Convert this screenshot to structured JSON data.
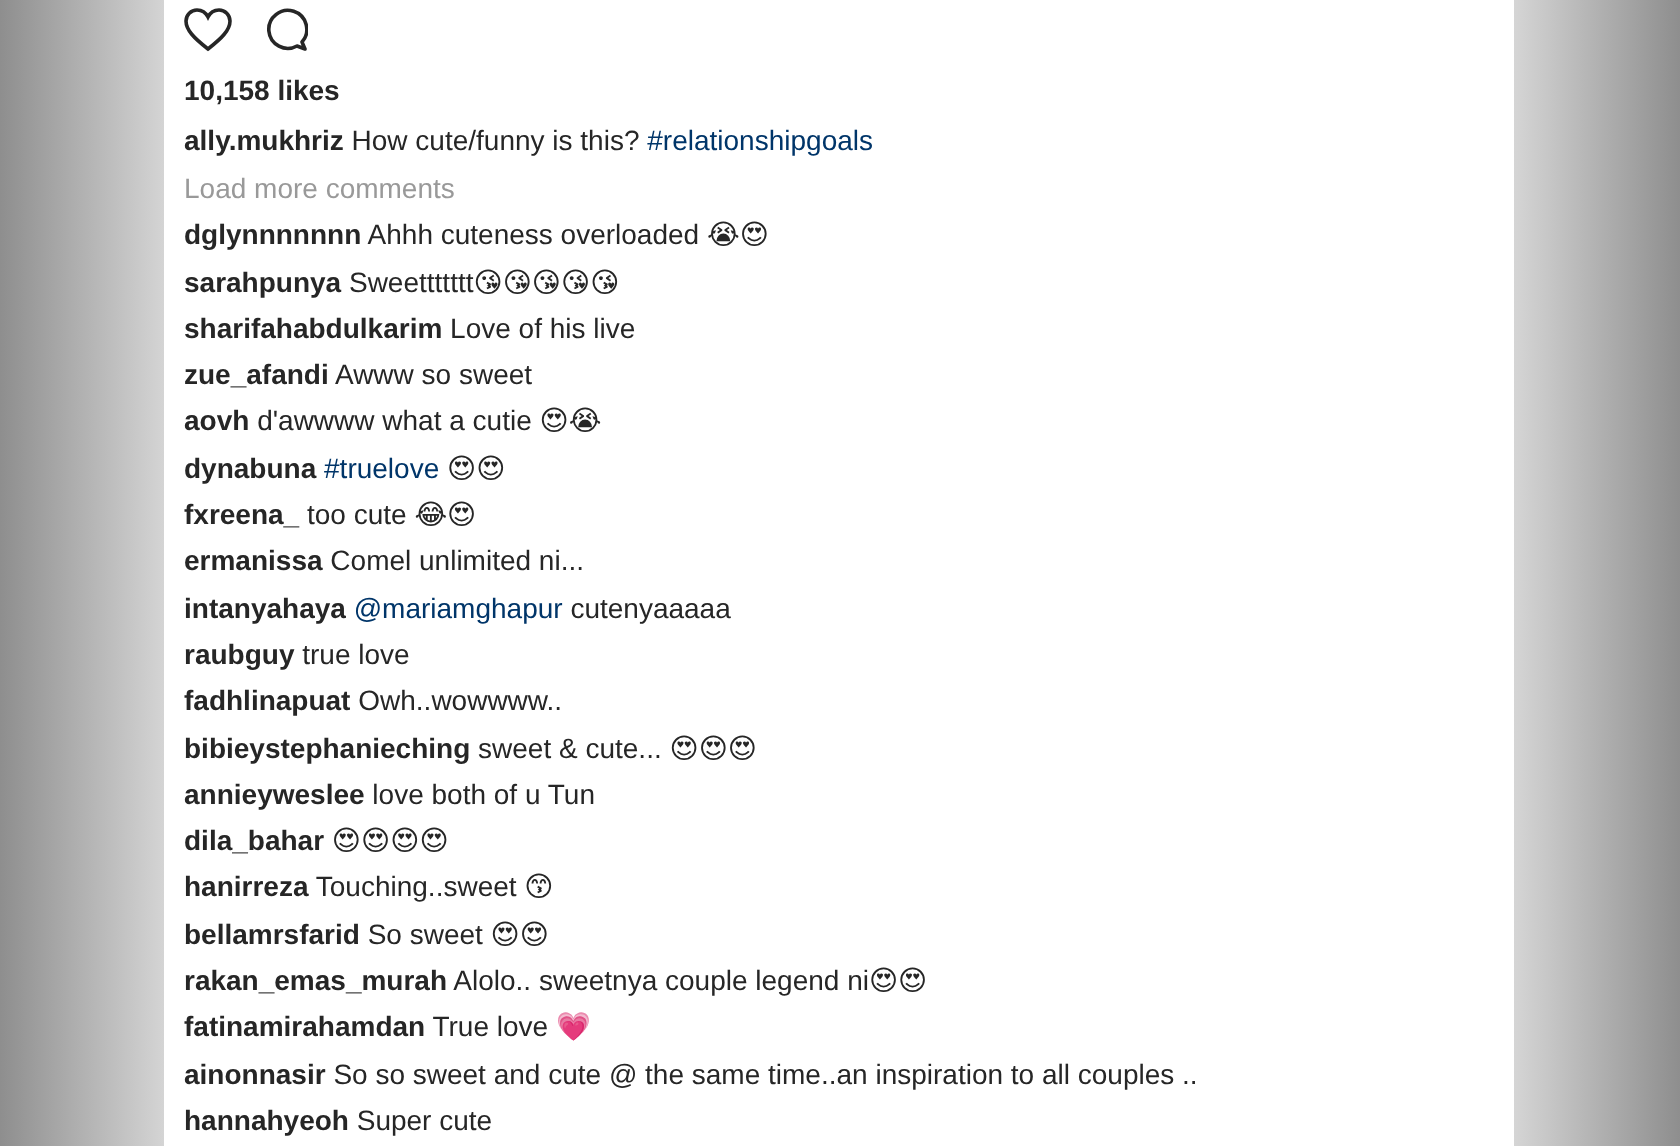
{
  "post": {
    "likes": "10,158 likes",
    "caption": {
      "user": "ally.mukhriz",
      "parts": [
        {
          "kind": "text",
          "text": "How cute/funny is this? "
        },
        {
          "kind": "link",
          "text": "#relationshipgoals"
        }
      ]
    },
    "load_more": "Load more comments",
    "comments": [
      {
        "user": "dglynnnnnnn",
        "parts": [
          {
            "kind": "text",
            "text": "Ahhh cuteness overloaded 😭😍"
          }
        ]
      },
      {
        "user": "sarahpunya",
        "parts": [
          {
            "kind": "text",
            "text": "Sweettttttt😘😘😘😘😘"
          }
        ]
      },
      {
        "user": "sharifahabdulkarim",
        "parts": [
          {
            "kind": "text",
            "text": "Love of his live"
          }
        ]
      },
      {
        "user": "zue_afandi",
        "parts": [
          {
            "kind": "text",
            "text": "Awww so sweet"
          }
        ]
      },
      {
        "user": "aovh",
        "parts": [
          {
            "kind": "text",
            "text": "d'awwww what a cutie 😍😭"
          }
        ]
      },
      {
        "user": "dynabuna",
        "parts": [
          {
            "kind": "link",
            "text": "#truelove"
          },
          {
            "kind": "text",
            "text": " 😍😍"
          }
        ]
      },
      {
        "user": "fxreena_",
        "parts": [
          {
            "kind": "text",
            "text": "too cute 😂😍"
          }
        ]
      },
      {
        "user": "ermanissa",
        "parts": [
          {
            "kind": "text",
            "text": "Comel unlimited ni..."
          }
        ]
      },
      {
        "user": "intanyahaya",
        "parts": [
          {
            "kind": "link",
            "text": "@mariamghapur"
          },
          {
            "kind": "text",
            "text": " cutenyaaaaa"
          }
        ]
      },
      {
        "user": "raubguy",
        "parts": [
          {
            "kind": "text",
            "text": "true love"
          }
        ]
      },
      {
        "user": "fadhlinapuat",
        "parts": [
          {
            "kind": "text",
            "text": "Owh..wowwww.."
          }
        ]
      },
      {
        "user": "bibieystephanieching",
        "parts": [
          {
            "kind": "text",
            "text": "sweet & cute... 😍😍😍"
          }
        ]
      },
      {
        "user": "annieyweslee",
        "parts": [
          {
            "kind": "text",
            "text": "love both of u Tun"
          }
        ]
      },
      {
        "user": "dila_bahar",
        "parts": [
          {
            "kind": "text",
            "text": "😍😍😍😍"
          }
        ]
      },
      {
        "user": "hanirreza",
        "parts": [
          {
            "kind": "text",
            "text": "Touching..sweet 😙"
          }
        ]
      },
      {
        "user": "bellamrsfarid",
        "parts": [
          {
            "kind": "text",
            "text": "So sweet 😍😍"
          }
        ]
      },
      {
        "user": "rakan_emas_murah",
        "parts": [
          {
            "kind": "text",
            "text": "Alolo.. sweetnya couple legend ni😍😍"
          }
        ]
      },
      {
        "user": "fatinamirahamdan",
        "parts": [
          {
            "kind": "text",
            "text": "True love 💗"
          }
        ]
      },
      {
        "user": "ainonnasir",
        "parts": [
          {
            "kind": "text",
            "text": "So so sweet and cute @ the same time..an inspiration to all couples .."
          }
        ]
      },
      {
        "user": "hannahyeoh",
        "parts": [
          {
            "kind": "text",
            "text": "Super cute"
          }
        ]
      }
    ]
  }
}
